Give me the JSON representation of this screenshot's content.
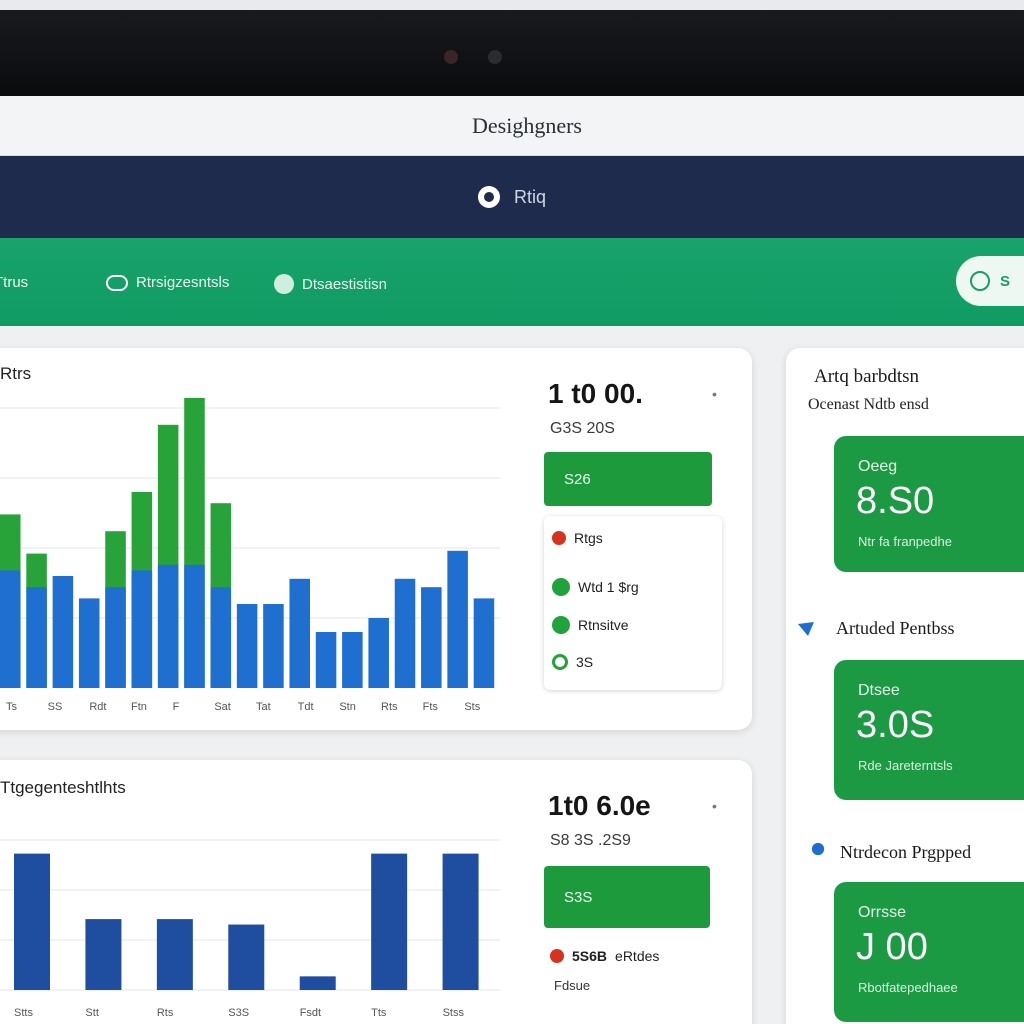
{
  "window": {
    "title": "Desighgners"
  },
  "navbar": {
    "label": "Rtiq"
  },
  "tabs": [
    {
      "label": "Ttrus"
    },
    {
      "label": "Rtrsigzesntsls"
    },
    {
      "label": "Dtsaestistisn"
    }
  ],
  "search": {
    "label": "S"
  },
  "panel_top": {
    "title": "Rtrs",
    "kpi_value": "1 t0 00.",
    "kpi_sub": "G3S 20S",
    "button_label": "S26",
    "legend": [
      {
        "label": "Rtgs",
        "color": "#d6321f"
      },
      {
        "label": "Wtd 1 $rg",
        "color": "#1fa33a"
      },
      {
        "label": "Rtnsitve",
        "color": "#1fa33a"
      },
      {
        "label": "3S",
        "color": "#1fa33a"
      }
    ],
    "x_labels": [
      "Ts",
      "SS",
      "Rdt",
      "Ftn",
      "F",
      "Sat",
      "Tat",
      "Tdt",
      "Stn",
      "Rts",
      "Fts",
      "Sts"
    ]
  },
  "panel_bottom": {
    "title": "Ttgegenteshtlhts",
    "kpi_value": "1t0 6.0e",
    "kpi_sub": "S8 3S .2S9",
    "button_label": "S3S",
    "legend": [
      {
        "label": "5S6B",
        "color": "#d6321f",
        "extra": "eRtdes"
      }
    ],
    "legend_note": "Fdsue",
    "x_labels": [
      "Stts",
      "Stt",
      "Rts",
      "S3S",
      "Fsdt",
      "Tts",
      "Stss"
    ]
  },
  "sidebar": {
    "title": "Artq barbdtsn",
    "subtitle": "Ocenast Ndtb ensd",
    "stats": [
      {
        "label": "Oeeg",
        "value": "8.S0",
        "note": "Ntr fa franpedhe"
      },
      {
        "label": "Dtsee",
        "value": "3.0S",
        "note": "Rde Jareterntsls"
      },
      {
        "label": "Orrsse",
        "value": "J 00",
        "note": "Rbotfatepedhaee"
      }
    ],
    "section2_title": "Artuded Pentbss",
    "section3_title": "Ntrdecon Prgpped"
  },
  "chart_data": [
    {
      "type": "bar",
      "title": "",
      "xlabel": "",
      "ylabel": "",
      "categories": [
        "Ts",
        "SS",
        "Rdt",
        "Ftn",
        "F",
        "Sat",
        "Tat",
        "Tdt",
        "Stn",
        "Rts",
        "Fts",
        "Sts"
      ],
      "series": [
        {
          "values": [
            42,
            36,
            40,
            32,
            36,
            42,
            44,
            44,
            36,
            30,
            30,
            39,
            20,
            20,
            25,
            39,
            36,
            49,
            32
          ]
        },
        {
          "values": [
            20,
            12,
            0,
            0,
            20,
            28,
            50,
            60,
            30,
            0,
            0,
            0,
            0,
            0,
            0,
            0,
            0,
            0,
            0
          ]
        }
      ],
      "ylim": [
        0,
        100
      ]
    },
    {
      "type": "bar",
      "title": "",
      "categories": [
        "Stts",
        "Stt",
        "Rts",
        "S3S",
        "Fsdt",
        "Tts",
        "Stss"
      ],
      "values": [
        100,
        52,
        52,
        48,
        10,
        100,
        100
      ],
      "ylim": [
        0,
        110
      ]
    }
  ],
  "colors": {
    "accent": "#1c9a43",
    "navbar": "#1f2b4d",
    "tabbar": "#14a06a",
    "bar_blue": "#1f6fd1",
    "bar_green": "#27a33a",
    "bar_navy": "#1f4ea0"
  }
}
